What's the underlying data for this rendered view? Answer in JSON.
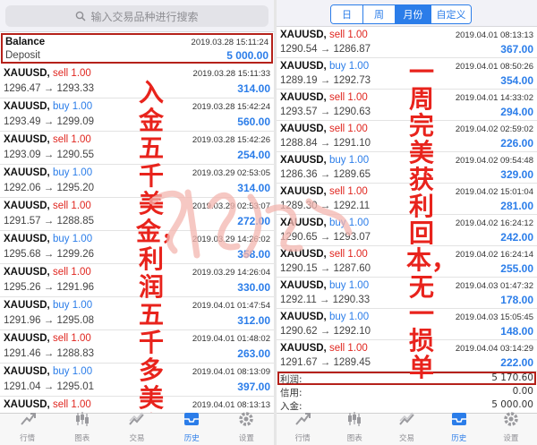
{
  "left": {
    "search_placeholder": "输入交易品种进行搜索",
    "balance": {
      "title": "Balance",
      "subtitle": "Deposit",
      "time": "2019.03.28 15:11:24",
      "amount": "5 000.00"
    },
    "rows": [
      {
        "symbol": "XAUUSD,",
        "side": "sell 1.00",
        "type": "sell",
        "prices": "1296.47 → 1293.33",
        "time": "2019.03.28 15:11:33",
        "profit": "314.00"
      },
      {
        "symbol": "XAUUSD,",
        "side": "buy 1.00",
        "type": "buy",
        "prices": "1293.49 → 1299.09",
        "time": "2019.03.28 15:42:24",
        "profit": "560.00"
      },
      {
        "symbol": "XAUUSD,",
        "side": "sell 1.00",
        "type": "sell",
        "prices": "1293.09 → 1290.55",
        "time": "2019.03.28 15:42:26",
        "profit": "254.00"
      },
      {
        "symbol": "XAUUSD,",
        "side": "buy 1.00",
        "type": "buy",
        "prices": "1292.06 → 1295.20",
        "time": "2019.03.29 02:53:05",
        "profit": "314.00"
      },
      {
        "symbol": "XAUUSD,",
        "side": "sell 1.00",
        "type": "sell",
        "prices": "1291.57 → 1288.85",
        "time": "2019.03.29 02:53:07",
        "profit": "272.00"
      },
      {
        "symbol": "XAUUSD,",
        "side": "buy 1.00",
        "type": "buy",
        "prices": "1295.68 → 1299.26",
        "time": "2019.03.29 14:26:02",
        "profit": "358.00"
      },
      {
        "symbol": "XAUUSD,",
        "side": "sell 1.00",
        "type": "sell",
        "prices": "1295.26 → 1291.96",
        "time": "2019.03.29 14:26:04",
        "profit": "330.00"
      },
      {
        "symbol": "XAUUSD,",
        "side": "buy 1.00",
        "type": "buy",
        "prices": "1291.96 → 1295.08",
        "time": "2019.04.01 01:47:54",
        "profit": "312.00"
      },
      {
        "symbol": "XAUUSD,",
        "side": "sell 1.00",
        "type": "sell",
        "prices": "1291.46 → 1288.83",
        "time": "2019.04.01 01:48:02",
        "profit": "263.00"
      },
      {
        "symbol": "XAUUSD,",
        "side": "buy 1.00",
        "type": "buy",
        "prices": "1291.04 → 1295.01",
        "time": "2019.04.01 08:13:09",
        "profit": "397.00"
      },
      {
        "symbol": "XAUUSD,",
        "side": "sell 1.00",
        "type": "sell",
        "prices": "",
        "time": "2019.04.01 08:13:13",
        "profit": ""
      }
    ],
    "overlay": "入金五千美金，利润五千多美金"
  },
  "right": {
    "period_tabs": [
      {
        "label": "日"
      },
      {
        "label": "周"
      },
      {
        "label": "月份"
      },
      {
        "label": "自定义"
      }
    ],
    "active_tab": "月份",
    "rows": [
      {
        "symbol": "XAUUSD,",
        "side": "sell 1.00",
        "type": "sell",
        "prices": "1290.54 → 1286.87",
        "time": "2019.04.01 08:13:13",
        "profit": "367.00"
      },
      {
        "symbol": "XAUUSD,",
        "side": "buy 1.00",
        "type": "buy",
        "prices": "1289.19 → 1292.73",
        "time": "2019.04.01 08:50:26",
        "profit": "354.00"
      },
      {
        "symbol": "XAUUSD,",
        "side": "sell 1.00",
        "type": "sell",
        "prices": "1293.57 → 1290.63",
        "time": "2019.04.01 14:33:02",
        "profit": "294.00"
      },
      {
        "symbol": "XAUUSD,",
        "side": "sell 1.00",
        "type": "sell",
        "prices": "1288.84 → 1291.10",
        "time": "2019.04.02 02:59:02",
        "profit": "226.00"
      },
      {
        "symbol": "XAUUSD,",
        "side": "buy 1.00",
        "type": "buy",
        "prices": "1286.36 → 1289.65",
        "time": "2019.04.02 09:54:48",
        "profit": "329.00"
      },
      {
        "symbol": "XAUUSD,",
        "side": "sell 1.00",
        "type": "sell",
        "prices": "1289.30 → 1292.11",
        "time": "2019.04.02 15:01:04",
        "profit": "281.00"
      },
      {
        "symbol": "XAUUSD,",
        "side": "buy 1.00",
        "type": "buy",
        "prices": "1290.65 → 1293.07",
        "time": "2019.04.02 16:24:12",
        "profit": "242.00"
      },
      {
        "symbol": "XAUUSD,",
        "side": "sell 1.00",
        "type": "sell",
        "prices": "1290.15 → 1287.60",
        "time": "2019.04.02 16:24:14",
        "profit": "255.00"
      },
      {
        "symbol": "XAUUSD,",
        "side": "buy 1.00",
        "type": "buy",
        "prices": "1292.11 → 1290.33",
        "time": "2019.04.03 01:47:32",
        "profit": "178.00"
      },
      {
        "symbol": "XAUUSD,",
        "side": "buy 1.00",
        "type": "buy",
        "prices": "1290.62 → 1292.10",
        "time": "2019.04.03 15:05:45",
        "profit": "148.00"
      },
      {
        "symbol": "XAUUSD,",
        "side": "sell 1.00",
        "type": "sell",
        "prices": "1291.67 → 1289.45",
        "time": "2019.04.04 03:14:29",
        "profit": "222.00"
      }
    ],
    "summary": {
      "profit_label": "利润:",
      "profit_value": "5 170.60",
      "credit_label": "信用:",
      "credit_value": "0.00",
      "deposit_label": "入金:",
      "deposit_value": "5 000.00"
    },
    "overlay": "一周完美获利回本，无一损单"
  },
  "tabbar": [
    {
      "label": "行情",
      "icon": "quotes-icon"
    },
    {
      "label": "图表",
      "icon": "chart-candles-icon"
    },
    {
      "label": "交易",
      "icon": "trade-icon"
    },
    {
      "label": "历史",
      "icon": "history-icon"
    },
    {
      "label": "设置",
      "icon": "gear-icon"
    }
  ],
  "active_tab_label": "历史",
  "colors": {
    "accent": "#2b7de9",
    "sell": "#e0261f",
    "highlight_box": "#b5211a",
    "overlay_text": "#e8231c"
  }
}
